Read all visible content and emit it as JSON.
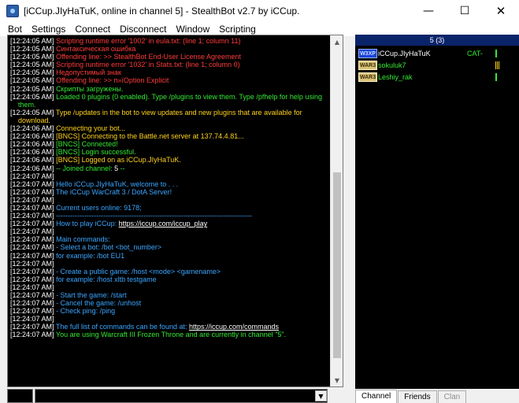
{
  "window": {
    "title": "[iCCup.JIyHaTuK, online in channel 5] - StealthBot v2.7 by iCCup.",
    "minimize_glyph": "—",
    "maximize_glyph": "☐",
    "close_glyph": "✕"
  },
  "menu": [
    "Bot",
    "Settings",
    "Connect",
    "Disconnect",
    "Window",
    "Scripting"
  ],
  "chat": {
    "lines": [
      {
        "ts": "[12:24:05 AM]",
        "text": "Scripting runtime error '1002' in eula.txt: (line 1; column 11)",
        "color": "red"
      },
      {
        "ts": "[12:24:05 AM]",
        "text": "Синтаксическая ошибка",
        "color": "red"
      },
      {
        "ts": "[12:24:05 AM]",
        "text": "Offending line: >> StealthBot End-User License Agreement",
        "color": "red"
      },
      {
        "ts": "[12:24:05 AM]",
        "text": "Scripting runtime error '1032' in Stats.txt: (line 1; column 0)",
        "color": "red"
      },
      {
        "ts": "[12:24:05 AM]",
        "text": "Недопустимый знак",
        "color": "red"
      },
      {
        "ts": "[12:24:05 AM]",
        "text": "Offending line: >> п»їOption Explicit",
        "color": "red"
      },
      {
        "ts": "[12:24:05 AM]",
        "text": "Скрипты загружены.",
        "color": "green"
      },
      {
        "ts": "[12:24:05 AM]",
        "text": "Loaded 0 plugins (0 enabled). Type /plugins to view them. Type /pfhelp for help using them.",
        "color": "green",
        "wrap": true
      },
      {
        "ts": "[12:24:05 AM]",
        "text": "Type /updates in the bot to view updates and new plugins that are available for download.",
        "color": "yellow",
        "wrap": true
      },
      {
        "ts": "[12:24:06 AM]",
        "text": "Connecting your bot...",
        "color": "yellow"
      },
      {
        "ts": "[12:24:06 AM]",
        "text": "[BNCS] Connecting to the Battle.net server at 137.74.4.81...",
        "color": "yellow"
      },
      {
        "ts": "[12:24:06 AM]",
        "text": "[BNCS] Connected!",
        "color": "green"
      },
      {
        "ts": "[12:24:06 AM]",
        "text": "[BNCS] Login successful.",
        "color": "green"
      },
      {
        "ts": "[12:24:06 AM]",
        "text": "[BNCS] Logged on as iCCup.JIyHaTuK.",
        "color": "yellow"
      },
      {
        "ts": "[12:24:06 AM]",
        "text": "-- Joined channel: ",
        "color": "green",
        "strong": "5",
        "suffix": " --"
      },
      {
        "ts": "[12:24:07 AM]",
        "text": "",
        "color": "cyan"
      },
      {
        "ts": "[12:24:07 AM]",
        "text": "Hello iCCup.JIyHaTuK, welcome to . . .",
        "color": "cyan"
      },
      {
        "ts": "[12:24:07 AM]",
        "text": "              The iCCup WarCraft 3 / DotA Server!",
        "color": "cyan"
      },
      {
        "ts": "[12:24:07 AM]",
        "text": "",
        "color": "cyan"
      },
      {
        "ts": "[12:24:07 AM]",
        "text": "  Current users online: 9178;",
        "color": "cyan"
      },
      {
        "ts": "[12:24:07 AM]",
        "text": "-----------------------------------------------------------------------------------",
        "color": "cyan"
      },
      {
        "ts": "[12:24:07 AM]",
        "text": "  How to play iCCup: ",
        "color": "cyan",
        "link": "https://iccup.com/iccup_play"
      },
      {
        "ts": "[12:24:07 AM]",
        "text": "",
        "color": "cyan"
      },
      {
        "ts": "[12:24:07 AM]",
        "text": "Main commands:",
        "color": "cyan"
      },
      {
        "ts": "[12:24:07 AM]",
        "text": "- Select a bot: /bot <bot_number>",
        "color": "cyan"
      },
      {
        "ts": "[12:24:07 AM]",
        "text": "  for example: /bot EU1",
        "color": "cyan"
      },
      {
        "ts": "[12:24:07 AM]",
        "text": "",
        "color": "cyan"
      },
      {
        "ts": "[12:24:07 AM]",
        "text": "- Create a public game: /host <mode> <gamename>",
        "color": "cyan"
      },
      {
        "ts": "[12:24:07 AM]",
        "text": "  for example: /host xltb testgame",
        "color": "cyan"
      },
      {
        "ts": "[12:24:07 AM]",
        "text": "",
        "color": "cyan"
      },
      {
        "ts": "[12:24:07 AM]",
        "text": "- Start the game: /start",
        "color": "cyan"
      },
      {
        "ts": "[12:24:07 AM]",
        "text": "- Cancel the game: /unhost",
        "color": "cyan"
      },
      {
        "ts": "[12:24:07 AM]",
        "text": "- Check ping: /ping",
        "color": "cyan"
      },
      {
        "ts": "[12:24:07 AM]",
        "text": "",
        "color": "cyan"
      },
      {
        "ts": "[12:24:07 AM]",
        "text": "The full list of commands can be found at: ",
        "color": "cyan",
        "link": "https://iccup.com/commands"
      },
      {
        "ts": "[12:24:07 AM]",
        "text": "You are using Warcraft III Frozen Throne and are currently in channel \"5\".",
        "color": "green"
      }
    ]
  },
  "input": {
    "value": "",
    "dropdown_glyph": "▼"
  },
  "channel": {
    "header": "5 (3)",
    "users": [
      {
        "badge": "W3XP",
        "badge_style": "w3xp-blue",
        "name": "iCCup.JIyHaTuK",
        "name_color": "white",
        "clan": "CAT-",
        "lag": "green"
      },
      {
        "badge": "WAR3",
        "badge_style": "war3",
        "name": "sokuluk7",
        "name_color": "green",
        "clan": "",
        "lag": "yellow"
      },
      {
        "badge": "WAR3",
        "badge_style": "war3",
        "name": "Leshiy_rak",
        "name_color": "green",
        "clan": "",
        "lag": "green"
      }
    ]
  },
  "tabs": [
    "Channel",
    "Friends",
    "Clan"
  ],
  "colors": {
    "red": "#ff3b3b",
    "green": "#35e935",
    "yellow": "#ffd21f",
    "cyan": "#3aa6ff",
    "header_bg": "#0a246a"
  }
}
